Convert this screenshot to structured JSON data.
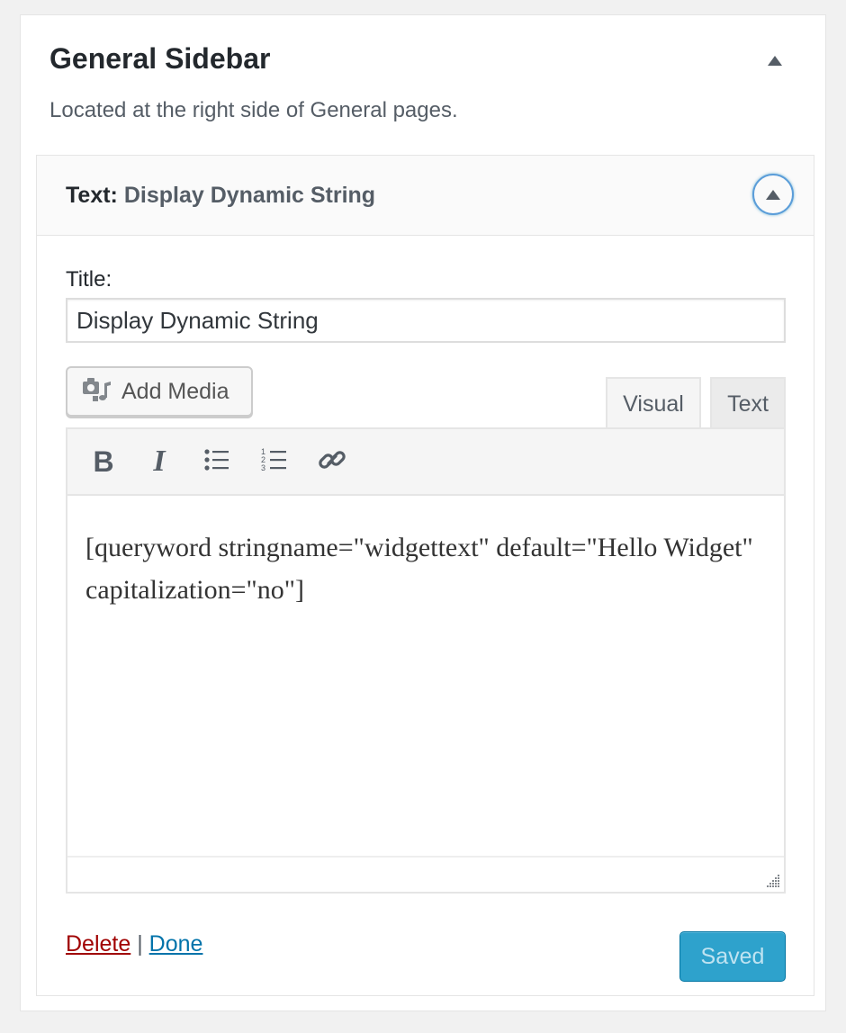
{
  "sidebar": {
    "title": "General Sidebar",
    "description": "Located at the right side of General pages."
  },
  "widget": {
    "type_label": "Text:",
    "instance_title": "Display Dynamic String",
    "title_label": "Title:",
    "title_value": "Display Dynamic String",
    "add_media_label": "Add Media",
    "tabs": [
      {
        "label": "Visual",
        "active": true
      },
      {
        "label": "Text",
        "active": false
      }
    ],
    "toolbar": {
      "bold": "B",
      "italic": "I",
      "bullet_list_icon": "bullet-list-icon",
      "numbered_list_icon": "numbered-list-icon",
      "link_icon": "link-icon"
    },
    "content": "[queryword stringname=\"widgettext\" default=\"Hello Widget\" capitalization=\"no\"]",
    "delete_label": "Delete",
    "separator": "|",
    "done_label": "Done",
    "save_label": "Saved"
  },
  "colors": {
    "accent": "#2ea2cc",
    "delete": "#a00000",
    "link": "#0073aa",
    "focus_ring": "#5b9dd9"
  }
}
